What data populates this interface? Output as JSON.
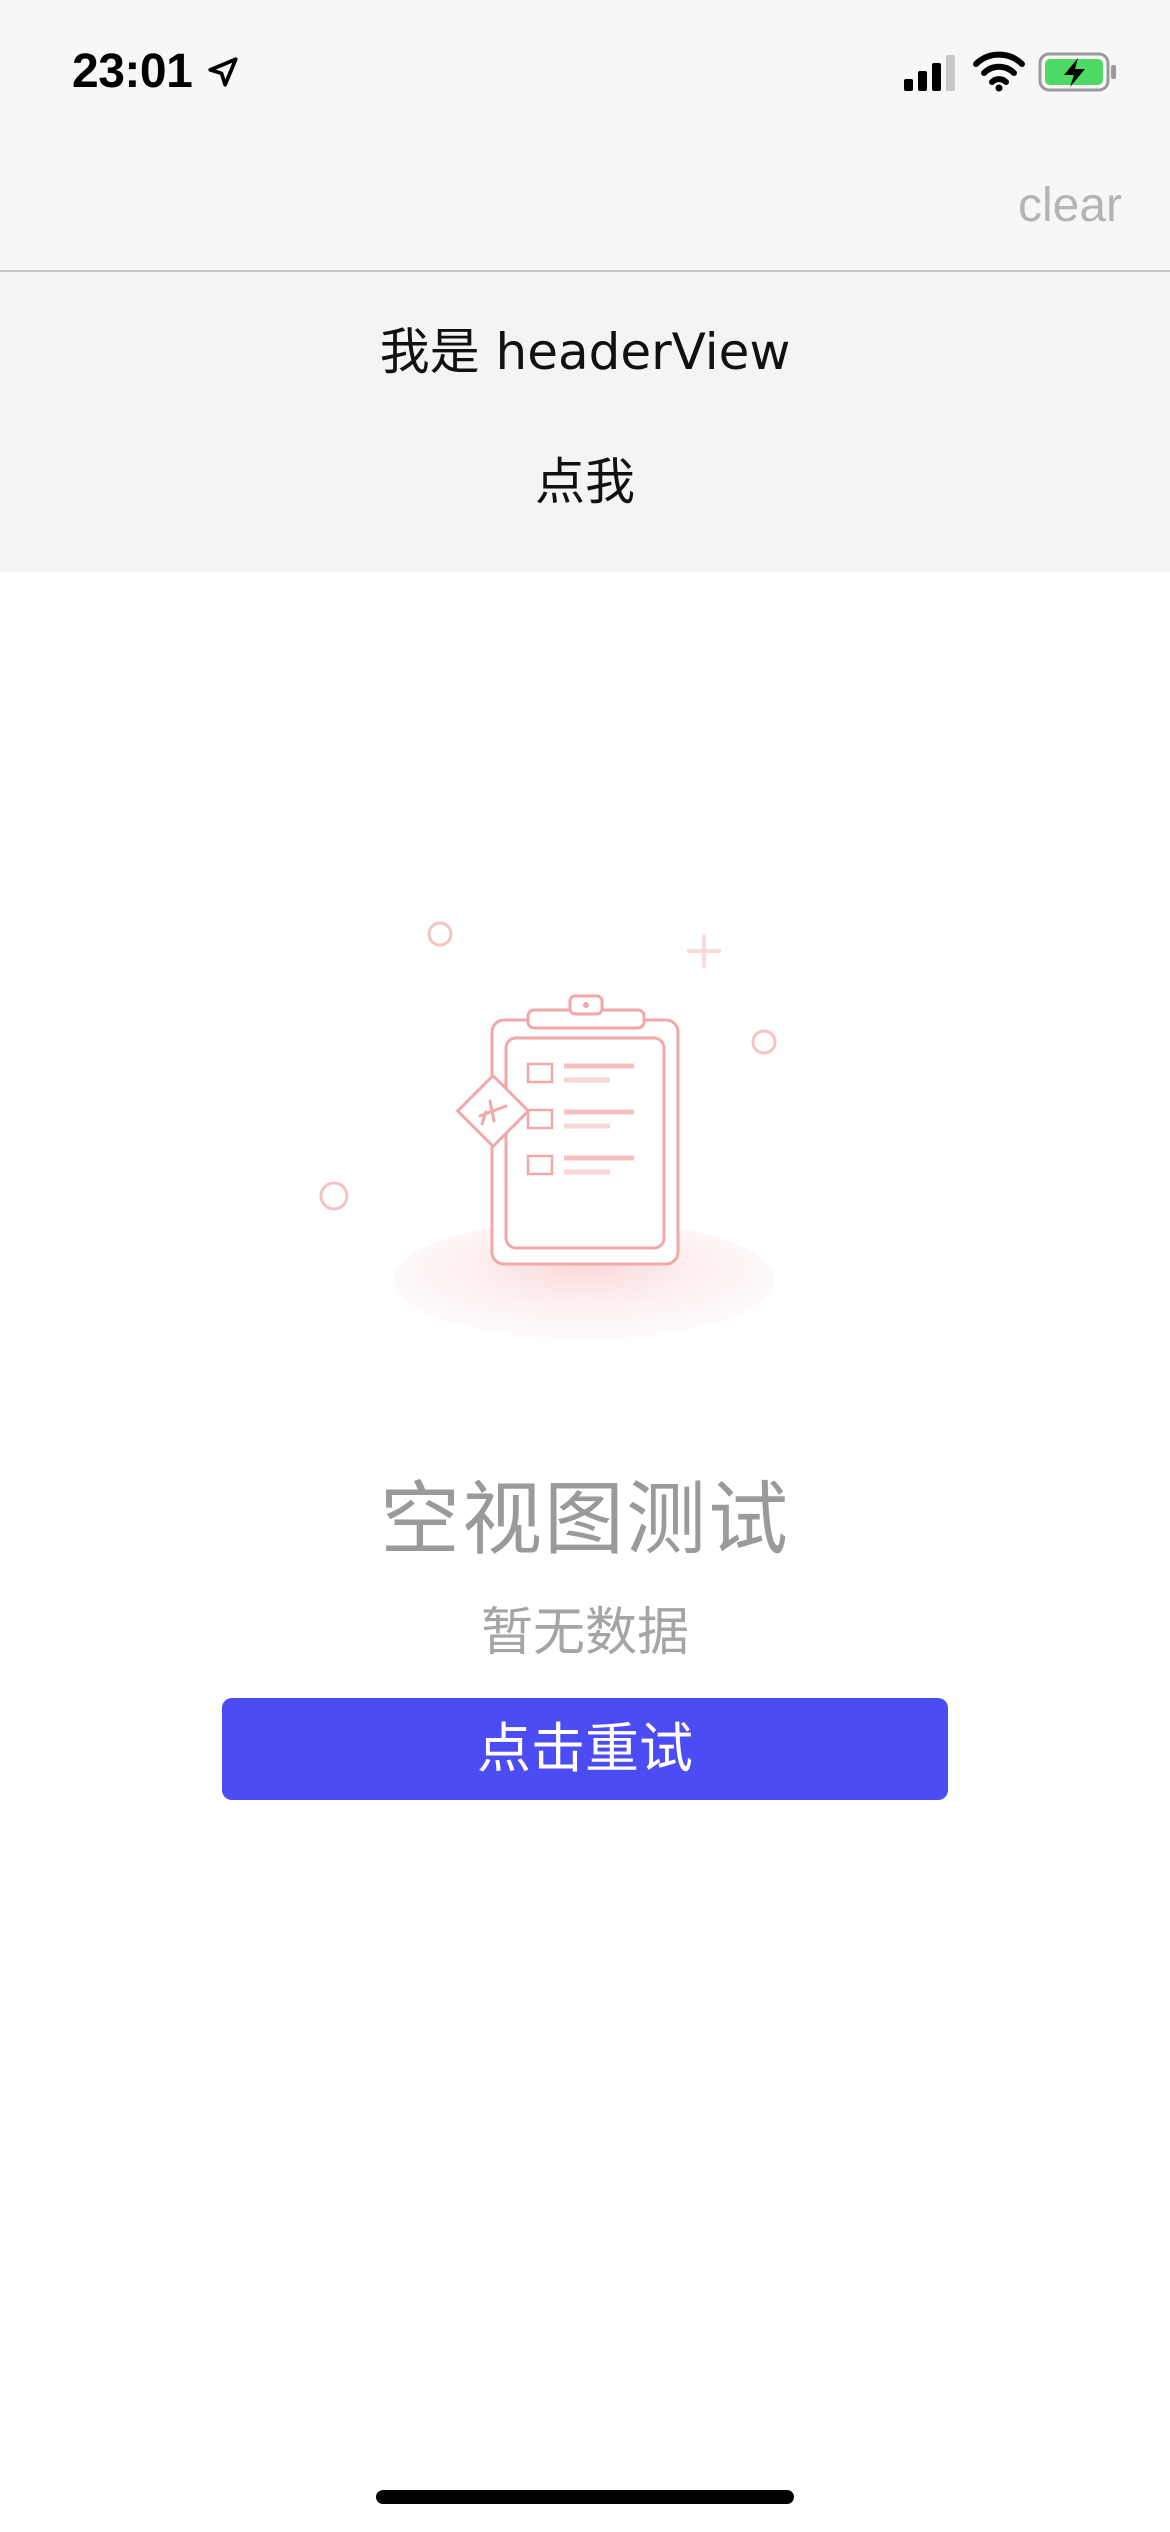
{
  "status_bar": {
    "time": "23:01",
    "location_icon": "location-arrow-icon",
    "signal_icon": "cellular-signal-icon",
    "wifi_icon": "wifi-icon",
    "battery_icon": "battery-charging-icon",
    "battery_color": "#4cd964"
  },
  "nav_bar": {
    "clear_label": "clear"
  },
  "header": {
    "title": "我是 headerView",
    "button_label": "点我"
  },
  "empty_state": {
    "illustration_icon": "clipboard-empty-icon",
    "title": "空视图测试",
    "subtitle": "暂无数据",
    "retry_label": "点击重试",
    "accent_color": "#4c4cf5",
    "illustration_color": "#f2a7a9"
  }
}
